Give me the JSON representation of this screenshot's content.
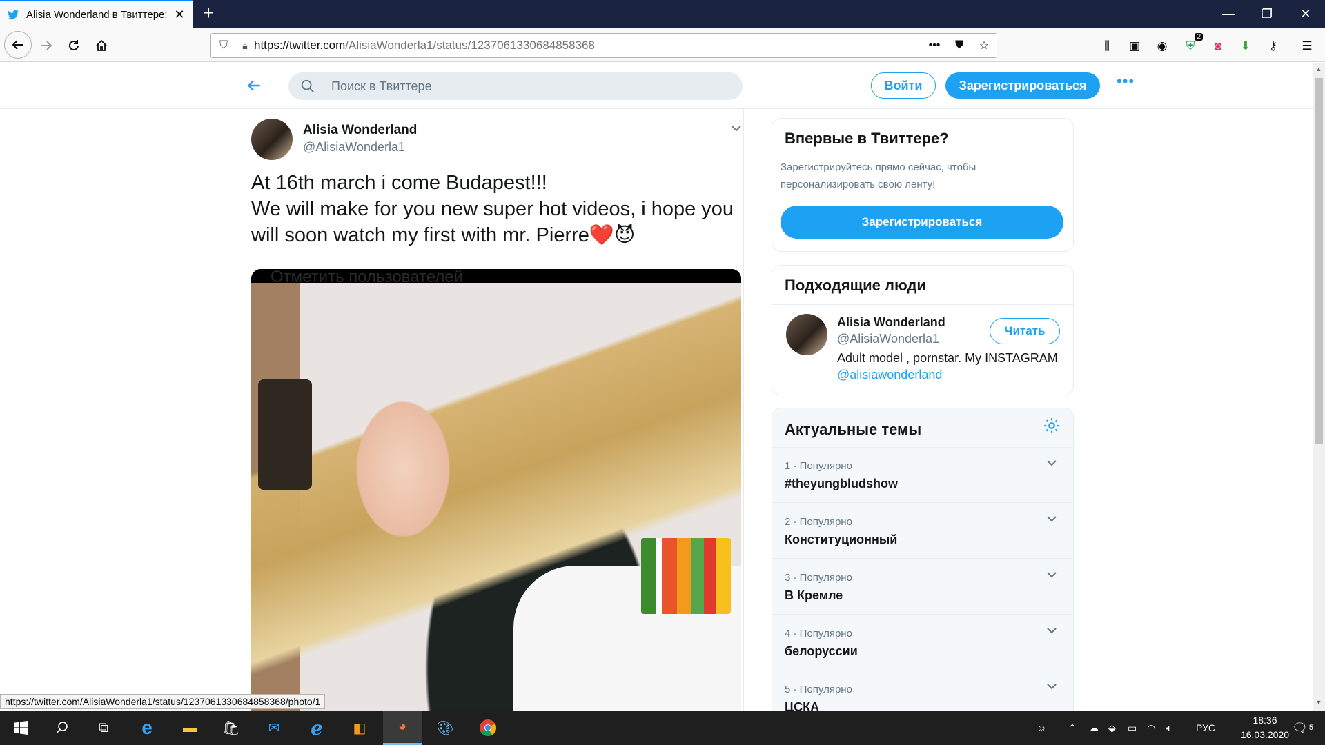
{
  "browser": {
    "tab_title": "Alisia Wonderland в Твиттере:",
    "url_host": "https://twitter.com",
    "url_path": "/AlisiaWonderla1/status/1237061330684858368",
    "status_url": "https://twitter.com/AlisiaWonderla1/status/1237061330684858368/photo/1",
    "badge_count": "2"
  },
  "twitter": {
    "search_placeholder": "Поиск в Твиттере",
    "login_label": "Войти",
    "signup_label": "Зарегистрироваться",
    "accent_color": "#1da1f2"
  },
  "tweet": {
    "author_name": "Alisia Wonderland",
    "author_handle": "@AlisiaWonderla1",
    "text_line1": "At 16th march i come Budapest!!!",
    "text_line2": "We will make for you new super hot videos, i hope you will soon watch my first with mr. Pierre",
    "emoji": "❤️😈",
    "media_tag_text": "Отметить пользователей"
  },
  "sidebar": {
    "new_card": {
      "title": "Впервые в Твиттере?",
      "description": "Зарегистрируйтесь прямо сейчас, чтобы персонализировать свою ленту!",
      "cta": "Зарегистрироваться"
    },
    "people_card": {
      "title": "Подходящие люди",
      "name": "Alisia Wonderland",
      "handle": "@AlisiaWonderla1",
      "bio": "Adult model , pornstar. My INSTAGRAM ",
      "bio_mention": "@alisiawonderland",
      "follow_label": "Читать"
    },
    "trends_card": {
      "title": "Актуальные темы",
      "items": [
        {
          "meta": "1 · Популярно",
          "name": "#theyungbludshow"
        },
        {
          "meta": "2 · Популярно",
          "name": "Конституционный"
        },
        {
          "meta": "3 · Популярно",
          "name": "В Кремле"
        },
        {
          "meta": "4 · Популярно",
          "name": "белоруссии"
        },
        {
          "meta": "5 · Популярно",
          "name": "ЦСКА"
        }
      ]
    }
  },
  "taskbar": {
    "lang": "РУС",
    "time": "18:36",
    "date": "16.03.2020",
    "notifications": "5"
  }
}
